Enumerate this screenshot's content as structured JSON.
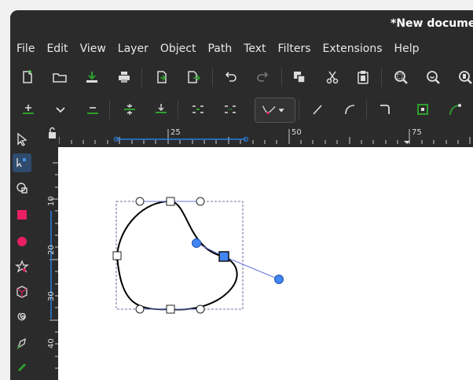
{
  "window": {
    "title": "*New documen"
  },
  "menu": {
    "items": [
      "File",
      "Edit",
      "View",
      "Layer",
      "Object",
      "Path",
      "Text",
      "Filters",
      "Extensions",
      "Help"
    ]
  },
  "toolbar_main": {
    "icons": [
      "new-document-icon",
      "open-file-icon",
      "save-icon",
      "print-icon",
      "import-icon",
      "export-icon",
      "undo-icon",
      "redo-icon",
      "duplicate-icon",
      "cut-icon",
      "paste-icon",
      "zoom-selection-icon",
      "zoom-drawing-icon",
      "zoom-page-icon"
    ]
  },
  "toolbar_ctrl": {
    "icons": [
      "insert-node-icon",
      "delete-node-chevron-icon",
      "remove-node-icon",
      "join-nodes-icon",
      "break-path-icon",
      "join-segment-icon",
      "delete-segment-icon",
      "node-type-dropdown-icon",
      "make-line-icon",
      "make-curve-icon",
      "make-cusp-icon",
      "show-bbox-icon",
      "show-handles-icon"
    ]
  },
  "toolbox": {
    "icons": [
      "selector-tool-icon",
      "node-tool-icon",
      "tweak-tool-icon",
      "rectangle-tool-icon",
      "ellipse-tool-icon",
      "star-tool-icon",
      "3d-box-tool-icon",
      "spiral-tool-icon",
      "pen-tool-icon",
      "calligraphy-tool-icon"
    ],
    "active": "node-tool-icon"
  },
  "rulers": {
    "horizontal_labels": [
      "25",
      "50",
      "75"
    ],
    "vertical_labels": [
      "10",
      "20",
      "30",
      "40"
    ]
  },
  "colors": {
    "panel": "#2b2b2b",
    "accent_blue": "#2a7de1",
    "node_handle": "#4285f4",
    "icon_green": "#2ca02c"
  }
}
